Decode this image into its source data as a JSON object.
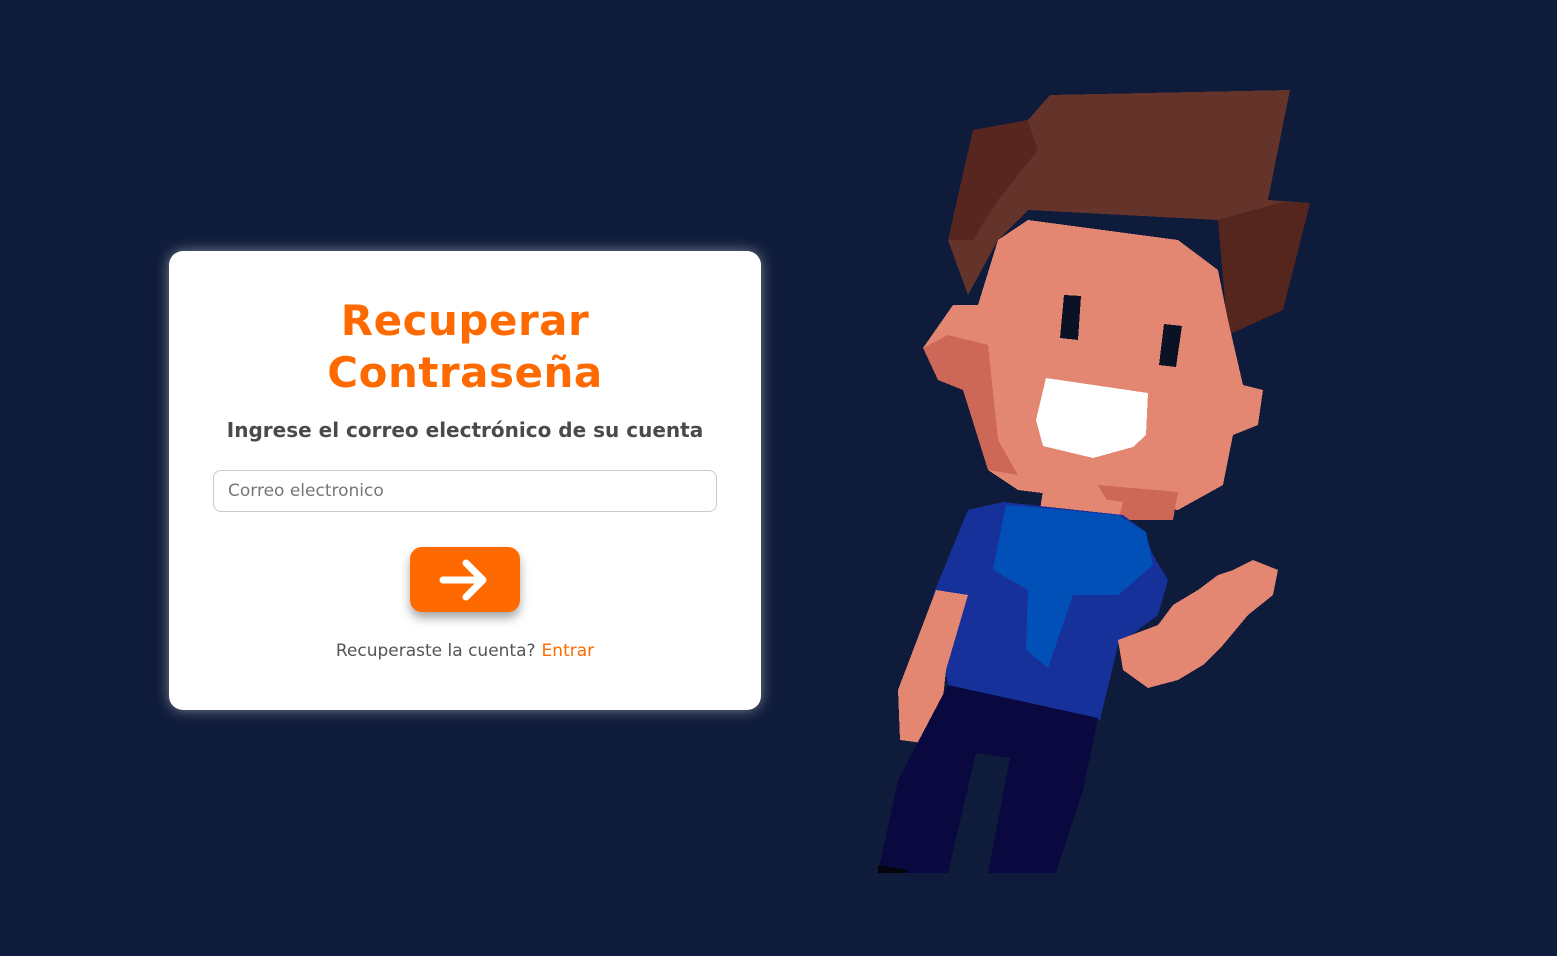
{
  "recover": {
    "title_line1": "Recuperar",
    "title_line2": "Contraseña",
    "subtitle": "Ingrese el correo electrónico de su cuenta",
    "email_placeholder": "Correo electronico",
    "email_value": "",
    "submit_icon": "arrow-right-icon",
    "footer_text": "Recuperaste la cuenta?",
    "footer_link": "Entrar"
  },
  "mascot": {
    "icon": "pixel-character-waving"
  },
  "colors": {
    "background": "#0e1b3a",
    "accent": "#ff6a00",
    "card": "#ffffff"
  }
}
